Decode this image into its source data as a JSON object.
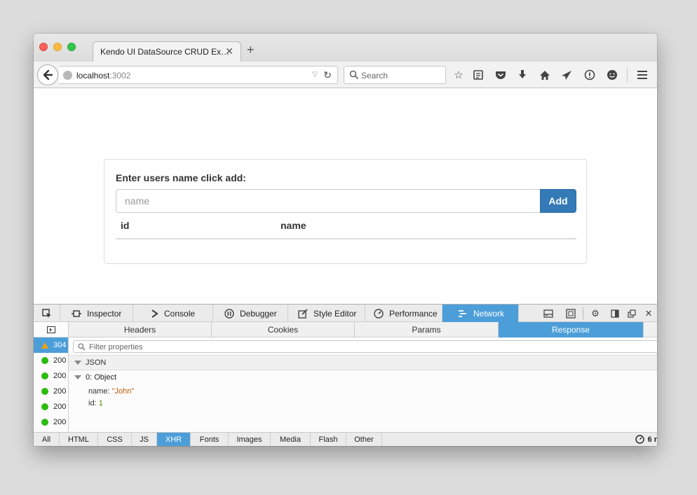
{
  "browser": {
    "tab_title": "Kendo UI DataSource CRUD Ex…",
    "tab_close": "✕",
    "new_tab": "+",
    "url_host": "localhost",
    "url_port": ":3002",
    "search_placeholder": "Search"
  },
  "page": {
    "label": "Enter users name click add:",
    "input_placeholder": "name",
    "add_label": "Add",
    "columns": [
      "id",
      "name"
    ]
  },
  "devtools": {
    "tabs": [
      {
        "label": "Inspector",
        "icon": "inspector-icon"
      },
      {
        "label": "Console",
        "icon": "console-icon"
      },
      {
        "label": "Debugger",
        "icon": "debugger-icon"
      },
      {
        "label": "Style Editor",
        "icon": "style-editor-icon"
      },
      {
        "label": "Performance",
        "icon": "performance-icon"
      },
      {
        "label": "Network",
        "icon": "network-icon",
        "active": true
      }
    ],
    "subtabs": [
      "Headers",
      "Cookies",
      "Params",
      "Response"
    ],
    "active_subtab": "Response",
    "requests": [
      "304",
      "200",
      "200",
      "200",
      "200",
      "200"
    ],
    "filter_placeholder": "Filter properties",
    "json_label": "JSON",
    "object_label": "0: Object",
    "props": [
      {
        "key": "name: ",
        "value": "\"John\"",
        "type": "string"
      },
      {
        "key": "id: ",
        "value": "1",
        "type": "number"
      }
    ],
    "filters": [
      "All",
      "HTML",
      "CSS",
      "JS",
      "XHR",
      "Fonts",
      "Images",
      "Media",
      "Flash",
      "Other"
    ],
    "active_filter": "XHR",
    "summary": "6 r"
  },
  "colors": {
    "accent": "#4c9ed9",
    "button": "#337ab7"
  }
}
